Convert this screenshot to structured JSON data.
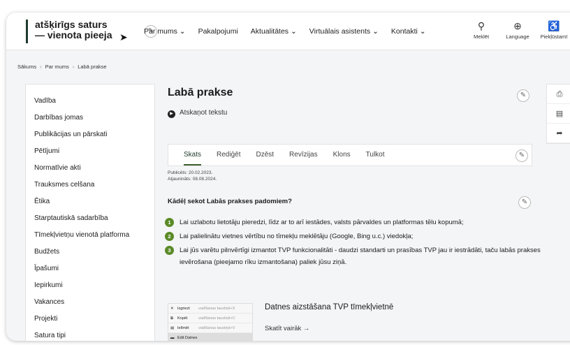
{
  "header": {
    "logo_line1": "atšķirīgs saturs",
    "logo_line2": "— vienota pieeja",
    "nav": [
      {
        "label": "Par mums",
        "dropdown": true
      },
      {
        "label": "Pakalpojumi",
        "dropdown": false
      },
      {
        "label": "Aktualitātes",
        "dropdown": true
      },
      {
        "label": "Virtuālais asistents",
        "dropdown": true
      },
      {
        "label": "Kontakti",
        "dropdown": true
      }
    ],
    "tools": [
      {
        "icon": "search-icon",
        "glyph": "⚲",
        "label": "Meklēt"
      },
      {
        "icon": "globe-icon",
        "glyph": "⊕",
        "label": "Language"
      },
      {
        "icon": "accessibility-icon",
        "glyph": "♿",
        "label": "Piekļūstamī"
      }
    ]
  },
  "breadcrumb": [
    "Sākums",
    "Par mums",
    "Labā prakse"
  ],
  "sidebar": {
    "items": [
      "Vadība",
      "Darbības jomas",
      "Publikācijas un pārskati",
      "Pētījumi",
      "Normatīvie akti",
      "Trauksmes celšana",
      "Ētika",
      "Starptautiskā sadarbība",
      "Tīmekļvietņu vienotā platforma",
      "Budžets",
      "Īpašumi",
      "Iepirkumi",
      "Vakances",
      "Projekti",
      "Satura tipi"
    ]
  },
  "main": {
    "title": "Labā prakse",
    "listen_label": "Atskaņot tekstu",
    "tabs": [
      "Skats",
      "Rediģēt",
      "Dzēst",
      "Revīzijas",
      "Klons",
      "Tulkot"
    ],
    "active_tab": "Skats",
    "published": "Publicēts: 20.02.2023.",
    "updated": "Atjaunināts: 08.08.2024.",
    "question": "Kādēļ sekot Labās prakses padomiem?",
    "reasons": [
      {
        "num": "1",
        "text": "Lai uzlabotu lietotāju pieredzi, līdz ar to arī iestādes, valsts pārvaldes un platformas tēlu kopumā;"
      },
      {
        "num": "2",
        "text": "Lai palielinātu vietnes vērtību no tīmekļu meklētāju (Google, Bing u.c.) viedokļa;"
      },
      {
        "num": "3",
        "text": "Lai jūs varētu pilnvērtīgi izmantot TVP funkcionalitāti - daudzi standarti un prasības TVP jau ir iestrādāti, taču labās prakses ievērošana (pieejamo rīku izmantošana) paliek jūsu ziņā."
      }
    ],
    "card": {
      "title": "Datnes aizstāšana TVP tīmekļvietnē",
      "link": "Skatīt vairāk →",
      "thumb_rows": [
        {
          "icon": "✕",
          "label": "Izgriezt",
          "shortcut": "vadīšanas taustiņš+X"
        },
        {
          "icon": "⧉",
          "label": "Kopēt",
          "shortcut": "vadīšanas taustiņš+C"
        },
        {
          "icon": "▤",
          "label": "Ielīmēt",
          "shortcut": "vadīšanas taustiņš+V"
        },
        {
          "icon": "▬",
          "label": "Edit Datnes",
          "shortcut": ""
        }
      ]
    }
  },
  "side_tools": [
    {
      "icon": "print-icon",
      "glyph": "⎙"
    },
    {
      "icon": "document-icon",
      "glyph": "▤"
    },
    {
      "icon": "share-icon",
      "glyph": "➦"
    }
  ],
  "edit_glyph": "✎"
}
